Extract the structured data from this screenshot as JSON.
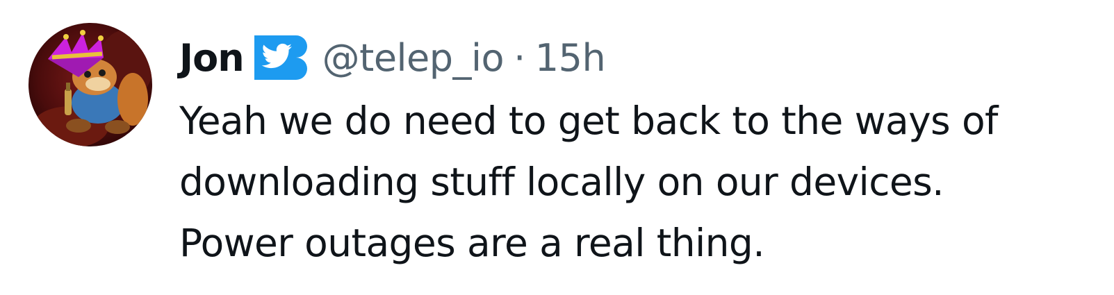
{
  "tweet": {
    "author": {
      "display_name": "Jon",
      "handle": "@telep_io",
      "verified": true,
      "avatar_icon": "crowned-squirrel-avatar"
    },
    "separator": "·",
    "timestamp": "15h",
    "text_lines": [
      "Yeah we do need to get back to the ways of",
      "downloading stuff locally on our devices.",
      "Power outages are a real thing."
    ]
  },
  "colors": {
    "primary_text": "#0f1419",
    "secondary_text": "#536471",
    "badge_blue": "#1d9bf0",
    "crown_magenta": "#cc22dd"
  }
}
